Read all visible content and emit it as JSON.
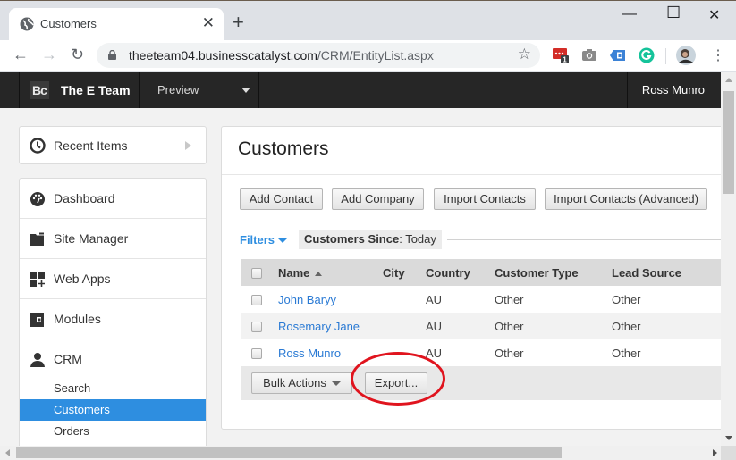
{
  "browser": {
    "tab_title": "Customers",
    "tab_close": "✕",
    "new_tab": "+",
    "window_controls": {
      "minimize": "—",
      "maximize": "☐",
      "close": "✕"
    },
    "nav": {
      "back": "←",
      "forward": "→",
      "reload": "↻"
    },
    "url_host": "theeteam04.businesscatalyst.com",
    "url_path": "/CRM/EntityList.aspx",
    "bookmark_star": "☆",
    "extensions": [
      {
        "icon": "lastpass-icon",
        "badge": "1",
        "color": "#d32d27"
      },
      {
        "icon": "camera-icon",
        "color": "#8a8a8a"
      },
      {
        "icon": "tag-extension-icon",
        "color": "#3b82d6"
      },
      {
        "icon": "grammarly-icon",
        "color": "#15c39a"
      }
    ],
    "menu": "⋮"
  },
  "app": {
    "logo": "Bc",
    "site_name": "The E Team",
    "preview_label": "Preview",
    "user_name": "Ross Munro"
  },
  "sidebar": {
    "recent_items": "Recent Items",
    "items": [
      {
        "label": "Dashboard",
        "icon": "dashboard-icon"
      },
      {
        "label": "Site Manager",
        "icon": "folder-icon"
      },
      {
        "label": "Web Apps",
        "icon": "web-apps-icon"
      },
      {
        "label": "Modules",
        "icon": "modules-icon"
      }
    ],
    "crm": {
      "label": "CRM",
      "subitems": [
        {
          "label": "Search",
          "active": false
        },
        {
          "label": "Customers",
          "active": true
        },
        {
          "label": "Orders",
          "active": false
        }
      ]
    }
  },
  "main": {
    "title": "Customers",
    "buttons": [
      "Add Contact",
      "Add Company",
      "Import Contacts",
      "Import Contacts (Advanced)"
    ],
    "filters_label": "Filters",
    "filter_chip": {
      "key": "Customers Since",
      "value": ": Today"
    },
    "table": {
      "columns": [
        "Name",
        "City",
        "Country",
        "Customer Type",
        "Lead Source"
      ],
      "rows": [
        {
          "name": "John Baryy",
          "city": "",
          "country": "AU",
          "type": "Other",
          "source": "Other"
        },
        {
          "name": "Rosemary Jane",
          "city": "",
          "country": "AU",
          "type": "Other",
          "source": "Other"
        },
        {
          "name": "Ross Munro",
          "city": "",
          "country": "AU",
          "type": "Other",
          "source": "Other"
        }
      ]
    },
    "bulk_actions": "Bulk Actions",
    "export": "Export..."
  },
  "colors": {
    "accent": "#2e8ee0",
    "link": "#2a7ad4",
    "highlight_ring": "#e0141e",
    "header_bg": "#262626"
  }
}
